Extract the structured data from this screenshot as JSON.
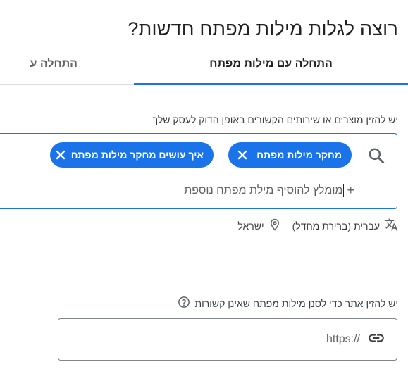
{
  "page": {
    "title": "רוצה לגלות מילות מפתח חדשות?"
  },
  "tabs": [
    {
      "label": "התחלה עם מילות מפתח",
      "active": true
    },
    {
      "label": "התחלה ע",
      "active": false
    }
  ],
  "keywords_field": {
    "label": "יש להזין מוצרים או שירותים הקשורים באופן הדוק לעסק שלך",
    "chips": [
      {
        "label": "מחקר מילות מפתח"
      },
      {
        "label": "איך עושים מחקר מילות מפתח"
      }
    ],
    "add_placeholder": "מומלץ להוסיף מילת מפתח נוספת",
    "add_icon": "+"
  },
  "locale": {
    "language": "עברית (ברירת מחדל)",
    "location": "ישראל",
    "translate_icon": "translate-icon",
    "location_icon": "location-pin-icon"
  },
  "site_field": {
    "label": "יש להזין אתר כדי לסנן מילות מפתח שאינן קשורות",
    "prefix": "https://",
    "help_icon": "help-circle-icon",
    "link_icon": "link-icon"
  },
  "colors": {
    "accent": "#1a73e8",
    "text": "#202124",
    "secondary_text": "#5f6368"
  }
}
